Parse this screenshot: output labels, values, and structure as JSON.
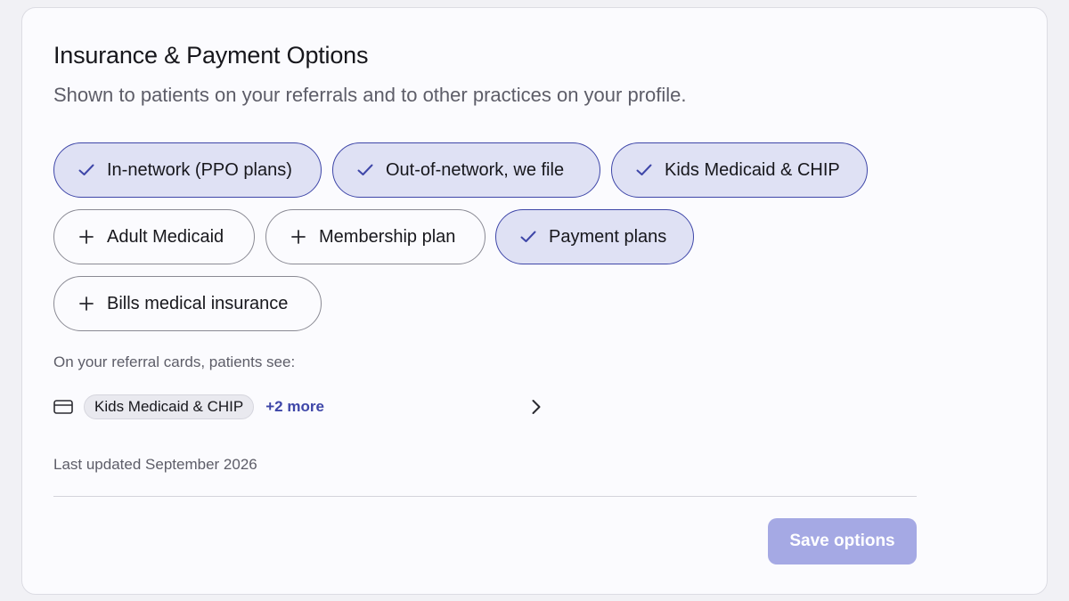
{
  "section": {
    "title": "Insurance & Payment Options",
    "subtitle": "Shown to patients on your referrals and to other practices on your profile."
  },
  "options": [
    {
      "label": "In-network (PPO plans)",
      "selected": true,
      "icon": "check-icon"
    },
    {
      "label": "Out-of-network, we file",
      "selected": true,
      "icon": "check-icon"
    },
    {
      "label": "Kids Medicaid & CHIP",
      "selected": true,
      "icon": "check-icon"
    },
    {
      "label": "Adult Medicaid",
      "selected": false,
      "icon": "plus-icon"
    },
    {
      "label": "Membership plan",
      "selected": false,
      "icon": "plus-icon"
    },
    {
      "label": "Payment plans",
      "selected": true,
      "icon": "check-icon"
    },
    {
      "label": "Bills medical insurance",
      "selected": false,
      "icon": "plus-icon"
    }
  ],
  "preview": {
    "label": "On your referral cards, patients see:",
    "icon": "credit-card-icon",
    "chip": "Kids Medicaid & CHIP",
    "more": "+2 more"
  },
  "last_updated": "Last updated September 2026",
  "save_button": {
    "label": "Save options",
    "state": "disabled"
  },
  "colors": {
    "accent": "#3e46a8",
    "selected_chip_bg": "#dfe1f4",
    "save_button_bg": "#a5a9e4"
  }
}
